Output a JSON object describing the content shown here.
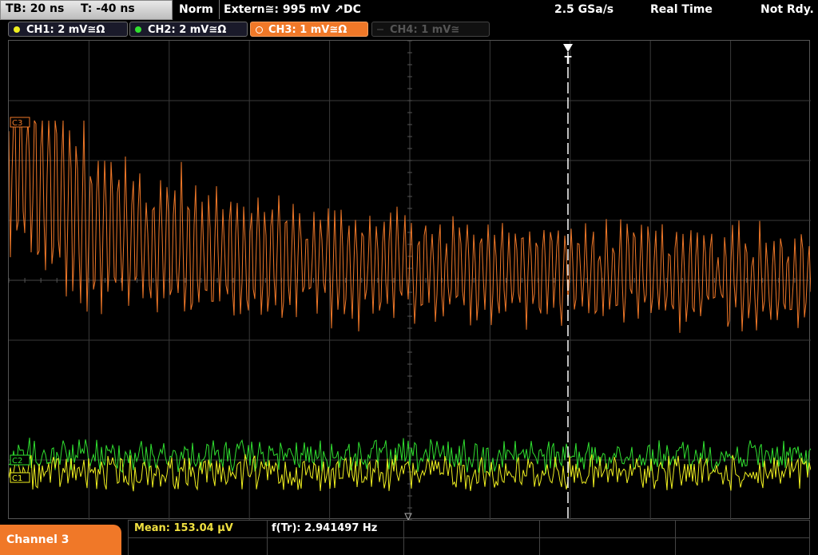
{
  "topbar": {
    "timebase": "TB: 20 ns",
    "trigger_time": "T: -40 ns",
    "mode": "Norm",
    "trigger_source": "Extern≅: 995 mV ↗DC",
    "sample_rate": "2.5 GSa/s",
    "acq_mode": "Real Time",
    "status": "Not Rdy."
  },
  "channels": [
    {
      "label": "CH1: 2 mV≅Ω",
      "color": "#f0f020",
      "state": "on"
    },
    {
      "label": "CH2: 2 mV≅Ω",
      "color": "#30e030",
      "state": "on"
    },
    {
      "label": "CH3: 1 mV≅Ω",
      "color": "#f07828",
      "state": "active"
    },
    {
      "label": "CH4: 1 mV≅",
      "color": "#555555",
      "state": "off"
    }
  ],
  "markers": {
    "ch3": "C3",
    "ch2": "C2",
    "ch1": "C1",
    "trigger": "T"
  },
  "bottom": {
    "channel_tab": "Channel 3",
    "mean_label": "Mean: 153.04 µV",
    "freq_label": "f(Tr): 2.941497 Hz"
  },
  "colors": {
    "ch1": "#f0f020",
    "ch2": "#30e030",
    "ch3": "#f07828",
    "grid": "#3a3a3a"
  }
}
